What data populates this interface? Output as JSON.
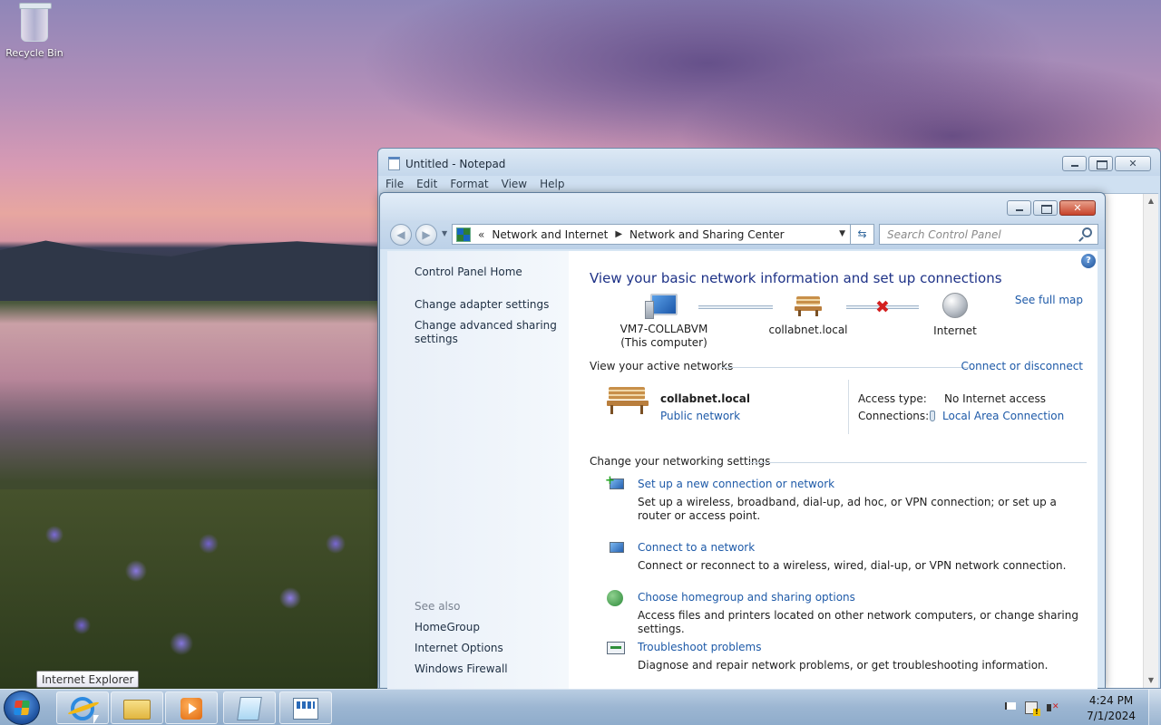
{
  "desktop": {
    "icons": [
      {
        "label": "Recycle Bin",
        "icon": "recycle-bin-icon"
      }
    ]
  },
  "notepad": {
    "title": "Untitled - Notepad",
    "menu": [
      "File",
      "Edit",
      "Format",
      "View",
      "Help"
    ]
  },
  "nsc": {
    "breadcrumb": [
      "Network and Internet",
      "Network and Sharing Center"
    ],
    "breadcrumb_overflow": "«",
    "search_placeholder": "Search Control Panel",
    "left_pane": {
      "links": [
        "Control Panel Home",
        "Change adapter settings",
        "Change advanced sharing settings"
      ],
      "see_also_label": "See also",
      "see_also": [
        "HomeGroup",
        "Internet Options",
        "Windows Firewall"
      ]
    },
    "main": {
      "title": "View your basic network information and set up connections",
      "see_full_map": "See full map",
      "map_nodes": [
        {
          "name": "VM7-COLLABVM",
          "sub": "(This computer)",
          "icon": "computer-icon"
        },
        {
          "name": "collabnet.local",
          "sub": "",
          "icon": "bench-network-icon"
        },
        {
          "name": "Internet",
          "sub": "",
          "icon": "globe-icon"
        }
      ],
      "broken_link": "✖",
      "active_networks_heading": "View your active networks",
      "connect_or_disconnect": "Connect or disconnect",
      "active_network": {
        "name": "collabnet.local",
        "type": "Public network",
        "access_type_label": "Access type:",
        "access_type_value": "No Internet access",
        "connections_label": "Connections:",
        "connections_value": "Local Area Connection"
      },
      "change_settings_heading": "Change your networking settings",
      "tasks": [
        {
          "title": "Set up a new connection or network",
          "desc": "Set up a wireless, broadband, dial-up, ad hoc, or VPN connection; or set up a router or access point.",
          "icon": "new-connection-icon"
        },
        {
          "title": "Connect to a network",
          "desc": "Connect or reconnect to a wireless, wired, dial-up, or VPN network connection.",
          "icon": "connect-network-icon"
        },
        {
          "title": "Choose homegroup and sharing options",
          "desc": "Access files and printers located on other network computers, or change sharing settings.",
          "icon": "homegroup-icon"
        },
        {
          "title": "Troubleshoot problems",
          "desc": "Diagnose and repair network problems, or get troubleshooting information.",
          "icon": "troubleshoot-icon"
        }
      ]
    }
  },
  "taskbar": {
    "tooltip": "Internet Explorer",
    "clock_time": "4:24 PM",
    "clock_date": "7/1/2024",
    "pinned": [
      "internet-explorer-icon",
      "windows-explorer-icon",
      "media-player-icon",
      "notepad-icon",
      "control-panel-icon"
    ]
  }
}
